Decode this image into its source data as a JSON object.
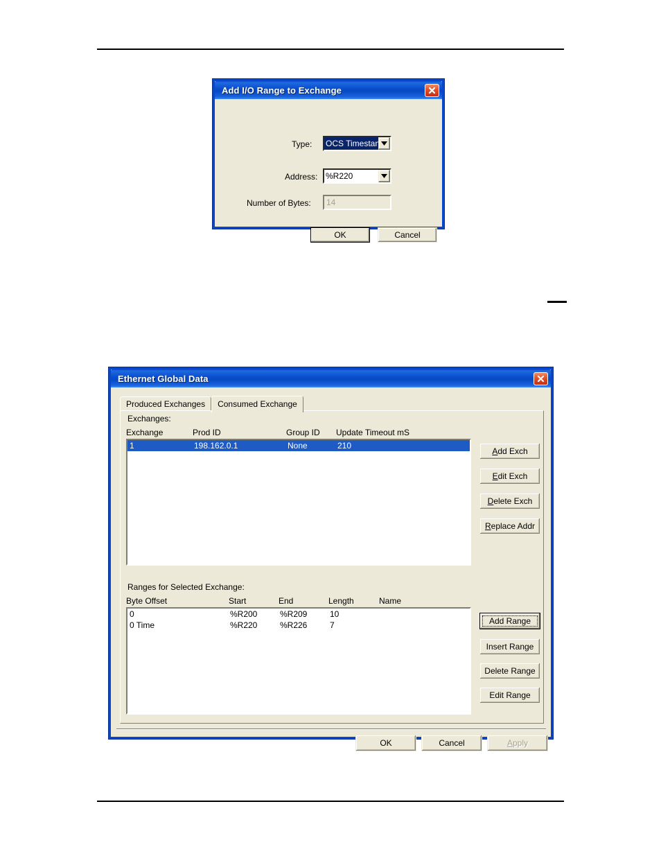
{
  "page": {
    "rules": [
      "header-rule",
      "footer-rule"
    ],
    "mid_dash": "—"
  },
  "add_range_dialog": {
    "title": "Add I/O Range to Exchange",
    "close_icon": "close-icon",
    "fields": {
      "type_label": "Type:",
      "type_value": "OCS Timestan",
      "type_dropdown_icon": "chevron-down-icon",
      "address_label": "Address:",
      "address_value": "%R220",
      "address_dropdown_icon": "chevron-down-icon",
      "bytes_label": "Number of Bytes:",
      "bytes_value": "14"
    },
    "buttons": {
      "ok": "OK",
      "cancel": "Cancel"
    }
  },
  "egd_dialog": {
    "title": "Ethernet Global Data",
    "close_icon": "close-icon",
    "tabs": [
      {
        "label": "Produced Exchanges",
        "active": false
      },
      {
        "label": "Consumed Exchange",
        "active": true
      }
    ],
    "exchanges": {
      "group_label": "Exchanges:",
      "columns": [
        "Exchange",
        "Prod ID",
        "Group ID",
        "Update Timeout mS"
      ],
      "rows": [
        {
          "exchange": "1",
          "prod_id": "198.162.0.1",
          "group_id": "None",
          "update_timeout": "210",
          "selected": true
        }
      ],
      "buttons": [
        {
          "name": "add-exch-button",
          "pre": "A",
          "post": "dd Exch"
        },
        {
          "name": "edit-exch-button",
          "pre": "E",
          "post": "dit Exch"
        },
        {
          "name": "delete-exch-button",
          "pre": "D",
          "post": "elete Exch"
        },
        {
          "name": "replace-addr-button",
          "pre": "R",
          "post": "eplace Addr"
        }
      ]
    },
    "ranges": {
      "group_label": "Ranges for Selected Exchange:",
      "columns": [
        "Byte Offset",
        "Start",
        "End",
        "Length",
        "Name"
      ],
      "rows": [
        {
          "byte_offset": "0",
          "start": "%R200",
          "end": "%R209",
          "length": "10",
          "name": ""
        },
        {
          "byte_offset": "0 Time",
          "start": "%R220",
          "end": "%R226",
          "length": "7",
          "name": ""
        }
      ],
      "buttons": [
        {
          "name": "add-range-button",
          "label": "Add Range",
          "focused": true
        },
        {
          "name": "insert-range-button",
          "label": "Insert Range",
          "focused": false
        },
        {
          "name": "delete-range-button",
          "label": "Delete Range",
          "focused": false
        },
        {
          "name": "edit-range-button",
          "label": "Edit Range",
          "focused": false
        }
      ]
    },
    "footer_buttons": {
      "ok": "OK",
      "cancel": "Cancel",
      "apply_pre": "A",
      "apply_post": "pply",
      "apply_disabled": true
    }
  },
  "colors": {
    "titlebar_blue": "#0b4fcf",
    "dialog_face": "#ece9d8",
    "selection_blue": "#1f5bc4",
    "combo_select_blue": "#0a246a",
    "close_red": "#e2502a",
    "frame_blue": "#0a46c8",
    "disabled_text": "#a6a392"
  }
}
